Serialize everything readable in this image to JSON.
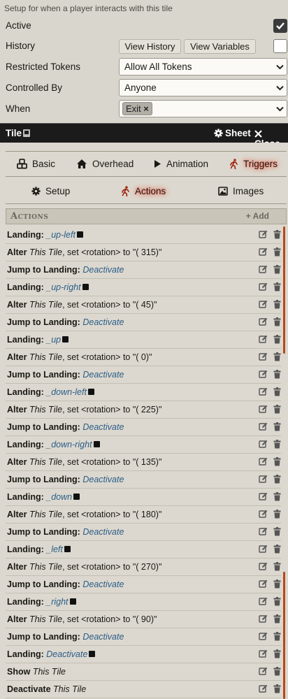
{
  "config": {
    "hint": "Setup for when a player interacts with this tile",
    "active_label": "Active",
    "active_checked": true,
    "history_label": "History",
    "view_history": "View History",
    "view_variables": "View Variables",
    "history_checked": false,
    "restricted_label": "Restricted Tokens",
    "restricted_value": "Allow All Tokens",
    "controlled_label": "Controlled By",
    "controlled_value": "Anyone",
    "when_label": "When",
    "when_tag": "Exit",
    "when_tag_remove": "×"
  },
  "header": {
    "title": "Tile",
    "sheet": "Sheet",
    "close": "Close"
  },
  "tabs": {
    "main": [
      "Basic",
      "Overhead",
      "Animation",
      "Triggers"
    ],
    "main_active": "Triggers",
    "sub": [
      "Setup",
      "Actions",
      "Images"
    ],
    "sub_active": "Actions"
  },
  "actions": {
    "title": "Actions",
    "add": "+ Add",
    "rows": [
      {
        "parts": [
          [
            "kw",
            "Landing:"
          ],
          [
            "t",
            " "
          ],
          [
            "lnk",
            "_up-left"
          ],
          [
            "sq",
            ""
          ]
        ]
      },
      {
        "parts": [
          [
            "kw",
            "Alter"
          ],
          [
            "t",
            " "
          ],
          [
            "em",
            "This Tile"
          ],
          [
            "t",
            ", set <rotation> to \"( 315)\""
          ]
        ]
      },
      {
        "parts": [
          [
            "kw",
            "Jump to Landing:"
          ],
          [
            "t",
            " "
          ],
          [
            "lnk",
            "Deactivate"
          ]
        ]
      },
      {
        "parts": [
          [
            "kw",
            "Landing:"
          ],
          [
            "t",
            " "
          ],
          [
            "lnk",
            "_up-right"
          ],
          [
            "sq",
            ""
          ]
        ]
      },
      {
        "parts": [
          [
            "kw",
            "Alter"
          ],
          [
            "t",
            " "
          ],
          [
            "em",
            "This Tile"
          ],
          [
            "t",
            ", set <rotation> to \"( 45)\""
          ]
        ]
      },
      {
        "parts": [
          [
            "kw",
            "Jump to Landing:"
          ],
          [
            "t",
            " "
          ],
          [
            "lnk",
            "Deactivate"
          ]
        ]
      },
      {
        "parts": [
          [
            "kw",
            "Landing:"
          ],
          [
            "t",
            " "
          ],
          [
            "lnk",
            "_up"
          ],
          [
            "sq",
            ""
          ]
        ]
      },
      {
        "parts": [
          [
            "kw",
            "Alter"
          ],
          [
            "t",
            " "
          ],
          [
            "em",
            "This Tile"
          ],
          [
            "t",
            ", set <rotation> to \"( 0)\""
          ]
        ]
      },
      {
        "parts": [
          [
            "kw",
            "Jump to Landing:"
          ],
          [
            "t",
            " "
          ],
          [
            "lnk",
            "Deactivate"
          ]
        ]
      },
      {
        "parts": [
          [
            "kw",
            "Landing:"
          ],
          [
            "t",
            " "
          ],
          [
            "lnk",
            "_down-left"
          ],
          [
            "sq",
            ""
          ]
        ]
      },
      {
        "parts": [
          [
            "kw",
            "Alter"
          ],
          [
            "t",
            " "
          ],
          [
            "em",
            "This Tile"
          ],
          [
            "t",
            ", set <rotation> to \"( 225)\""
          ]
        ]
      },
      {
        "parts": [
          [
            "kw",
            "Jump to Landing:"
          ],
          [
            "t",
            " "
          ],
          [
            "lnk",
            "Deactivate"
          ]
        ]
      },
      {
        "parts": [
          [
            "kw",
            "Landing:"
          ],
          [
            "t",
            " "
          ],
          [
            "lnk",
            "_down-right"
          ],
          [
            "sq",
            ""
          ]
        ]
      },
      {
        "parts": [
          [
            "kw",
            "Alter"
          ],
          [
            "t",
            " "
          ],
          [
            "em",
            "This Tile"
          ],
          [
            "t",
            ", set <rotation> to \"( 135)\""
          ]
        ]
      },
      {
        "parts": [
          [
            "kw",
            "Jump to Landing:"
          ],
          [
            "t",
            " "
          ],
          [
            "lnk",
            "Deactivate"
          ]
        ]
      },
      {
        "parts": [
          [
            "kw",
            "Landing:"
          ],
          [
            "t",
            " "
          ],
          [
            "lnk",
            "_down"
          ],
          [
            "sq",
            ""
          ]
        ]
      },
      {
        "parts": [
          [
            "kw",
            "Alter"
          ],
          [
            "t",
            " "
          ],
          [
            "em",
            "This Tile"
          ],
          [
            "t",
            ", set <rotation> to \"( 180)\""
          ]
        ]
      },
      {
        "parts": [
          [
            "kw",
            "Jump to Landing:"
          ],
          [
            "t",
            " "
          ],
          [
            "lnk",
            "Deactivate"
          ]
        ]
      },
      {
        "parts": [
          [
            "kw",
            "Landing:"
          ],
          [
            "t",
            " "
          ],
          [
            "lnk",
            "_left"
          ],
          [
            "sq",
            ""
          ]
        ]
      },
      {
        "parts": [
          [
            "kw",
            "Alter"
          ],
          [
            "t",
            " "
          ],
          [
            "em",
            "This Tile"
          ],
          [
            "t",
            ", set <rotation> to \"( 270)\""
          ]
        ]
      },
      {
        "parts": [
          [
            "kw",
            "Jump to Landing:"
          ],
          [
            "t",
            " "
          ],
          [
            "lnk",
            "Deactivate"
          ]
        ]
      },
      {
        "parts": [
          [
            "kw",
            "Landing:"
          ],
          [
            "t",
            " "
          ],
          [
            "lnk",
            "_right"
          ],
          [
            "sq",
            ""
          ]
        ]
      },
      {
        "parts": [
          [
            "kw",
            "Alter"
          ],
          [
            "t",
            " "
          ],
          [
            "em",
            "This Tile"
          ],
          [
            "t",
            ", set <rotation> to \"( 90)\""
          ]
        ]
      },
      {
        "parts": [
          [
            "kw",
            "Jump to Landing:"
          ],
          [
            "t",
            " "
          ],
          [
            "lnk",
            "Deactivate"
          ]
        ]
      },
      {
        "parts": [
          [
            "kw",
            "Landing:"
          ],
          [
            "t",
            " "
          ],
          [
            "lnk",
            "Deactivate"
          ],
          [
            "sq",
            ""
          ]
        ]
      },
      {
        "parts": [
          [
            "kw",
            "Show"
          ],
          [
            "t",
            " "
          ],
          [
            "em",
            "This Tile"
          ]
        ]
      },
      {
        "parts": [
          [
            "kw",
            "Deactivate"
          ],
          [
            "t",
            " "
          ],
          [
            "em",
            "This Tile"
          ]
        ]
      }
    ]
  },
  "colors": {
    "accent_glow": "#ff3b1f",
    "link": "#2b5e87",
    "scroll_marker": "#b5481a"
  }
}
